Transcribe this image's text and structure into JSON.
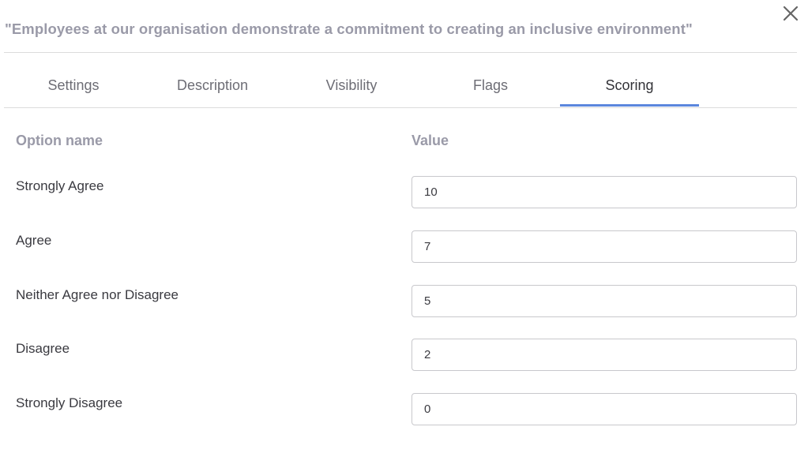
{
  "dialog": {
    "title": "\"Employees at our organisation demonstrate a commitment to creating an inclusive environment\"",
    "close_icon": "close-icon"
  },
  "tabs": [
    {
      "label": "Settings",
      "active": false
    },
    {
      "label": "Description",
      "active": false
    },
    {
      "label": "Visibility",
      "active": false
    },
    {
      "label": "Flags",
      "active": false
    },
    {
      "label": "Scoring",
      "active": true
    }
  ],
  "scoring": {
    "option_header": "Option name",
    "value_header": "Value",
    "rows": [
      {
        "option": "Strongly Agree",
        "value": "10"
      },
      {
        "option": "Agree",
        "value": "7"
      },
      {
        "option": "Neither Agree nor Disagree",
        "value": "5"
      },
      {
        "option": "Disagree",
        "value": "2"
      },
      {
        "option": "Strongly Disagree",
        "value": "0"
      }
    ]
  },
  "colors": {
    "accent": "#5b86dd",
    "muted_text": "#9a9aa8",
    "body_text": "#3a3a40"
  }
}
